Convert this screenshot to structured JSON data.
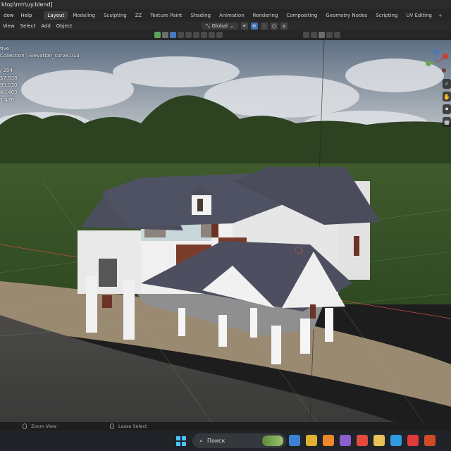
{
  "window": {
    "title": "ktop\\rrrr\\uy.blend]"
  },
  "menubar": {
    "menus": [
      "dow",
      "Help"
    ],
    "tabs": [
      "Layout",
      "Modeling",
      "Sculpting",
      "ZZ",
      "Texture Paint",
      "Shading",
      "Animation",
      "Rendering",
      "Compositing",
      "Geometry Nodes",
      "Scripting",
      "UV Editing"
    ],
    "active_tab": "Layout",
    "add_tab": "+"
  },
  "header": {
    "menus": [
      "View",
      "Select",
      "Add",
      "Object"
    ],
    "orientation": "Global"
  },
  "overlay_stats": {
    "lines": [
      "tive",
      "Collection | Elevation_curve.013",
      "",
      "/ 204",
      "57,838",
      "95,030",
      "40,463",
      "1,476"
    ]
  },
  "statusbar": {
    "hint_left": "Zoom View",
    "hint_right": "Lasso Select"
  },
  "taskbar": {
    "search_placeholder": "Поиск",
    "apps": [
      {
        "name": "meet-app",
        "color": "#3b82d6"
      },
      {
        "name": "file-explorer-app",
        "color": "#e0b030"
      },
      {
        "name": "blender-app",
        "color": "#f0862a"
      },
      {
        "name": "visual-studio-app",
        "color": "#8c5fd0"
      },
      {
        "name": "chrome-app",
        "color": "#e24b3b"
      },
      {
        "name": "folder-app",
        "color": "#e9c25a"
      },
      {
        "name": "edge-app",
        "color": "#2f9be0"
      },
      {
        "name": "anydesk-app",
        "color": "#e03a3a"
      },
      {
        "name": "powerpoint-app",
        "color": "#d04a26"
      }
    ]
  },
  "accent": "#4a78c0"
}
